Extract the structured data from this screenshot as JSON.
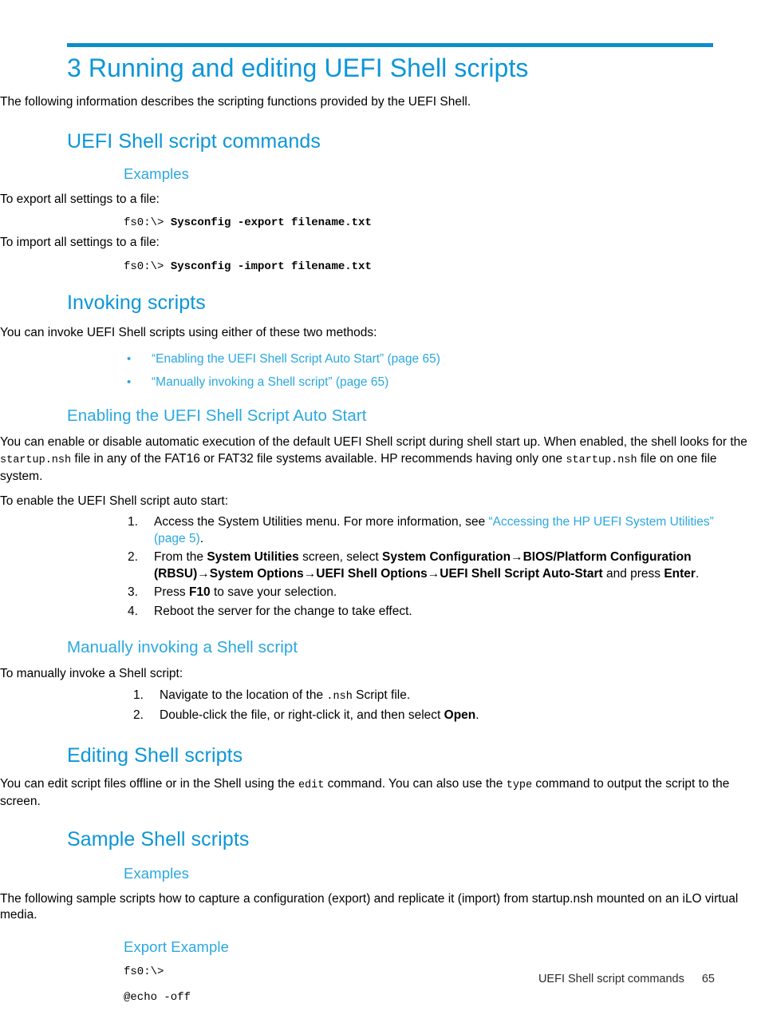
{
  "colors": {
    "rule": "#0c8ecb",
    "chapter_heading": "#0c96d8",
    "section_heading": "#0c96d8",
    "sub_heading": "#2aa8e0",
    "link": "#2aa8e0",
    "body_text": "#000000",
    "footer_text": "#2b2b2b"
  },
  "chapter": {
    "title": "3 Running and editing UEFI Shell scripts",
    "intro": "The following information describes the scripting functions provided by the UEFI Shell."
  },
  "sections": {
    "uefi_shell_script_commands": {
      "heading": "UEFI Shell script commands",
      "examples_heading": "Examples",
      "export_intro": "To export all settings to a file:",
      "export_prompt": "fs0:\\> ",
      "export_command": "Sysconfig -export filename.txt",
      "import_intro": "To import all settings to a file:",
      "import_prompt": "fs0:\\> ",
      "import_command": "Sysconfig -import filename.txt"
    },
    "invoking_scripts": {
      "heading": "Invoking scripts",
      "intro": "You can invoke UEFI Shell scripts using either of these two methods:",
      "bullet_glyph": "•",
      "bullets": [
        "“Enabling the UEFI Shell Script Auto Start” (page 65)",
        "“Manually invoking a Shell script” (page 65)"
      ]
    },
    "enabling_auto_start": {
      "heading": "Enabling the UEFI Shell Script Auto Start",
      "para_part1": "You can enable or disable automatic execution of the default UEFI Shell script during shell start up. When enabled, the shell looks for the ",
      "para_code1": "startup.nsh",
      "para_part2": " file in any of the FAT16 or FAT32 file systems available. HP recommends having only one ",
      "para_code2": "startup.nsh",
      "para_part3": " file on one file system.",
      "lead_in": "To enable the UEFI Shell script auto start:",
      "step1_text_a": "Access the System Utilities menu. For more information, see ",
      "step1_link": "“Accessing the HP UEFI System Utilities” (page 5)",
      "step1_text_b": ".",
      "step2_a": "From the ",
      "step2_b1": "System Utilities",
      "step2_c": " screen, select ",
      "step2_b2": "System Configuration",
      "step2_arrow1": "→",
      "step2_b3": "BIOS/Platform Configuration (RBSU)",
      "step2_arrow2": "→",
      "step2_b4": "System Options",
      "step2_arrow3": "→",
      "step2_b5": "UEFI Shell Options",
      "step2_arrow4": "→",
      "step2_b6": "UEFI Shell Script Auto-Start",
      "step2_d": " and press ",
      "step2_b7": "Enter",
      "step2_e": ".",
      "step3_a": "Press ",
      "step3_b": "F10",
      "step3_c": " to save your selection.",
      "step4": "Reboot the server for the change to take effect."
    },
    "manually_invoking": {
      "heading": "Manually invoking a Shell script",
      "lead_in": "To manually invoke a Shell script:",
      "step1_a": "Navigate to the location of the ",
      "step1_code": ".nsh",
      "step1_b": " Script file.",
      "step2_a": "Double-click the file, or right-click it, and then select ",
      "step2_b": "Open",
      "step2_c": "."
    },
    "editing_shell_scripts": {
      "heading": "Editing Shell scripts",
      "para_a": "You can edit script files offline or in the Shell using the ",
      "para_code1": "edit",
      "para_b": " command. You can also use the ",
      "para_code2": "type",
      "para_c": " command to output the script to the screen."
    },
    "sample_shell_scripts": {
      "heading": "Sample Shell scripts",
      "examples_heading": "Examples",
      "examples_para": "The following sample scripts how to capture a configuration (export) and replicate it (import) from startup.nsh mounted on an iLO virtual media.",
      "export_example_heading": "Export Example",
      "code_line_1": "fs0:\\>",
      "code_line_2": "@echo -off"
    }
  },
  "footer": {
    "section_label": "UEFI Shell script commands",
    "page_number": "65"
  }
}
